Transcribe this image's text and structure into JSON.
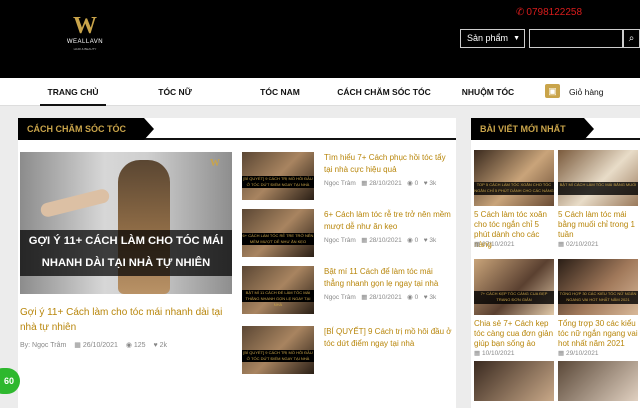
{
  "header": {
    "logo_name": "WEALLAVN",
    "logo_sub": "HAIR & BEAUTY",
    "phone": "0798122258",
    "category_select": "Sản phẩm",
    "search_placeholder": ""
  },
  "nav": {
    "items": [
      {
        "label": "TRANG CHỦ"
      },
      {
        "label": "TÓC NỮ"
      },
      {
        "label": "TÓC NAM"
      },
      {
        "label": "CÁCH CHĂM SÓC TÓC"
      },
      {
        "label": "NHUỘM TÓC"
      }
    ],
    "cart_label": "Giỏ hàng"
  },
  "main": {
    "section_title": "CÁCH CHĂM SÓC TÓC",
    "featured": {
      "caption_line1": "GỢI Ý 11+ CÁCH LÀM CHO TÓC MÁI",
      "caption_line2": "NHANH DÀI TẠI NHÀ TỰ NHIÊN",
      "title": "Gợi ý 11+ Cách làm cho tóc mái nhanh dài tại nhà tự nhiên",
      "author": "By: Ngọc Trâm",
      "date": "26/10/2021",
      "views": "125",
      "likes": "2k"
    },
    "side_posts": [
      {
        "title": "Tìm hiểu 7+ Cách phục hồi tóc tẩy tại nhà cực hiệu quả",
        "author": "Ngọc Trâm",
        "date": "28/10/2021",
        "views": "0",
        "likes": "3k",
        "thumb_text": "[BÍ QUYẾT] 9 CÁCH TRỊ MỒ HÔI ĐẦU Ở TÓC DỨT ĐIỂM NGAY TẠI NHÀ"
      },
      {
        "title": "6+ Cách làm tóc rễ tre trở nên mềm mượt dễ như ăn kẹo",
        "author": "Ngọc Trâm",
        "date": "28/10/2021",
        "views": "0",
        "likes": "3k",
        "thumb_text": "6+ CÁCH LÀM TÓC RỄ TRE TRỞ NÊN MỀM MƯỢT DỄ NHƯ ĂN KẸO"
      },
      {
        "title": "Bật mí 11 Cách để làm tóc mái thẳng nhanh gọn lẹ ngay tại nhà",
        "author": "Ngọc Trâm",
        "date": "28/10/2021",
        "views": "0",
        "likes": "3k",
        "thumb_text": "BẬT MÍ 11 CÁCH ĐỂ LÀM TÓC MÁI THẲNG NHANH GỌN LẸ NGAY TẠI NHÀ"
      },
      {
        "title": "[BÍ QUYẾT] 9 Cách trị mồ hôi đầu ở tóc dứt điểm ngay tại nhà",
        "author": "",
        "date": "",
        "views": "",
        "likes": "",
        "thumb_text": "[BÍ QUYẾT] 9 CÁCH TRỊ MỒ HÔI ĐẦU Ở TÓC DỨT ĐIỂM NGAY TẠI NHÀ"
      }
    ]
  },
  "sidebar": {
    "section_title": "BÀI VIẾT MỚI NHẤT",
    "posts": [
      {
        "title": "5 Cách làm tóc xoăn cho tóc ngắn chỉ 5 phút dành cho các nàng",
        "date": "07/10/2021",
        "thumb_text": "TOP 5 CÁCH LÀM TÓC XOĂN CHO TÓC NGẮN CHỈ 5 PHÚT DÀNH CHO CÁC NÀNG"
      },
      {
        "title": "5 Cách làm tóc mái bằng muối chỉ trong 1 tuần",
        "date": "02/10/2021",
        "thumb_text": "BẬT MÍ CÁCH LÀM TÓC MÁI BẰNG MUỐI"
      },
      {
        "title": "Chia sẻ 7+ Cách kẹp tóc càng cua đơn giản giúp bạn sống ảo",
        "date": "10/10/2021",
        "thumb_text": "7+ CÁCH KẸP TÓC CÀNG CUA ĐẸP TRANG ĐƠN GIẢN"
      },
      {
        "title": "Tổng trợp 30 các kiểu tóc nữ ngắn ngang vai hot nhất năm 2021",
        "date": "29/10/2021",
        "thumb_text": "TỔNG HỢP 30 CÁC KIỂU TÓC NỮ NGẮN NGANG VAI HOT NHẤT NĂM 2021"
      }
    ]
  },
  "float_badge": "60"
}
